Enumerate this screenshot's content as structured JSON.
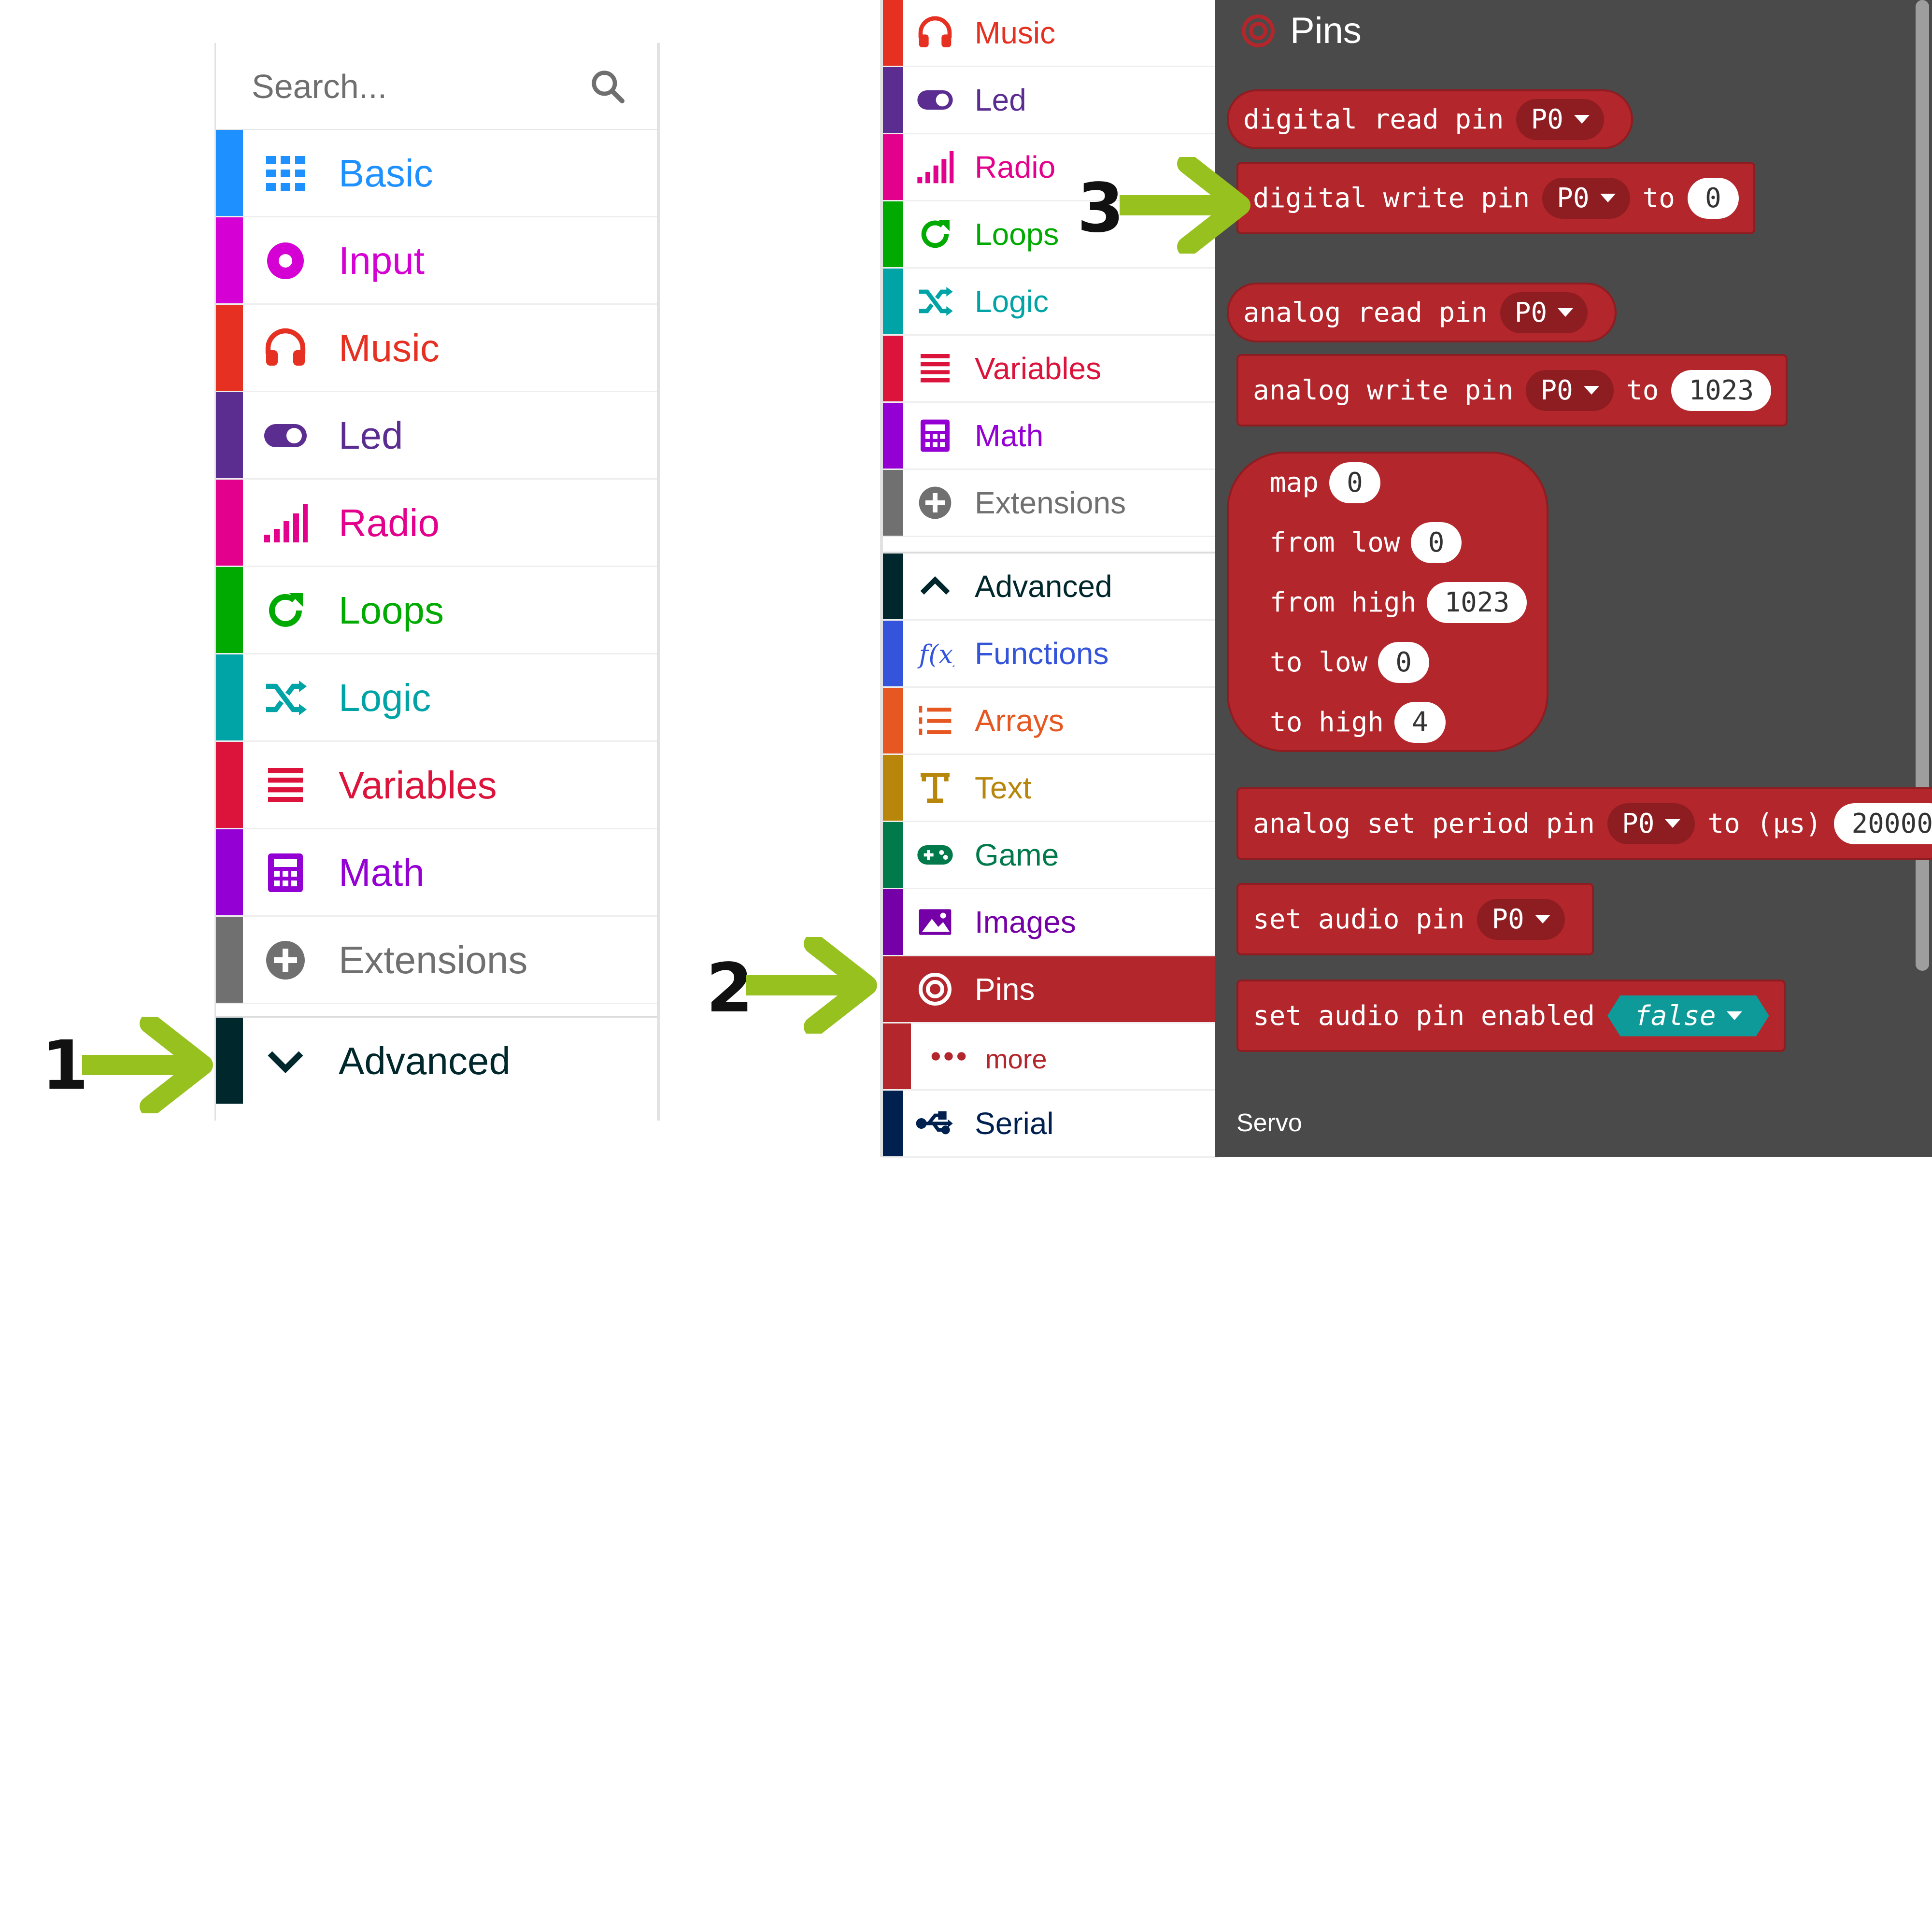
{
  "left_toolbox": {
    "search_placeholder": "Search...",
    "items": [
      {
        "label": "Basic",
        "color": "#1e90ff"
      },
      {
        "label": "Input",
        "color": "#d400d4"
      },
      {
        "label": "Music",
        "color": "#e63022"
      },
      {
        "label": "Led",
        "color": "#5c2d91"
      },
      {
        "label": "Radio",
        "color": "#e3008c"
      },
      {
        "label": "Loops",
        "color": "#00aa00"
      },
      {
        "label": "Logic",
        "color": "#00a4a6"
      },
      {
        "label": "Variables",
        "color": "#dc143c"
      },
      {
        "label": "Math",
        "color": "#9400d3"
      },
      {
        "label": "Extensions",
        "color": "#707070"
      }
    ],
    "advanced": {
      "label": "Advanced",
      "color": "#00272b"
    }
  },
  "mid_toolbox": {
    "items": [
      {
        "label": "Music",
        "color": "#e63022"
      },
      {
        "label": "Led",
        "color": "#5c2d91"
      },
      {
        "label": "Radio",
        "color": "#e3008c"
      },
      {
        "label": "Loops",
        "color": "#00aa00"
      },
      {
        "label": "Logic",
        "color": "#00a4a6"
      },
      {
        "label": "Variables",
        "color": "#dc143c"
      },
      {
        "label": "Math",
        "color": "#9400d3"
      },
      {
        "label": "Extensions",
        "color": "#707070"
      }
    ],
    "advanced_items": [
      {
        "label": "Advanced",
        "color": "#00272b"
      },
      {
        "label": "Functions",
        "color": "#3455db"
      },
      {
        "label": "Arrays",
        "color": "#e65722"
      },
      {
        "label": "Text",
        "color": "#b8860b"
      },
      {
        "label": "Game",
        "color": "#007a4b"
      },
      {
        "label": "Images",
        "color": "#7600a8"
      },
      {
        "label": "Pins",
        "color": "#b3262b"
      },
      {
        "label": "more",
        "color": "#b3262b"
      },
      {
        "label": "Serial",
        "color": "#002050"
      }
    ]
  },
  "flyout": {
    "title": "Pins",
    "blocks": {
      "digital_read": {
        "text": "digital read pin",
        "pin": "P0"
      },
      "digital_write": {
        "text": "digital write pin",
        "pin": "P0",
        "to": "to",
        "value": "0"
      },
      "analog_read": {
        "text": "analog read pin",
        "pin": "P0"
      },
      "analog_write": {
        "text": "analog write pin",
        "pin": "P0",
        "to": "to",
        "value": "1023"
      },
      "map": {
        "map": "map",
        "map_value": "0",
        "from_low": "from low",
        "from_low_value": "0",
        "from_high": "from high",
        "from_high_value": "1023",
        "to_low": "to low",
        "to_low_value": "0",
        "to_high": "to high",
        "to_high_value": "4"
      },
      "analog_set_period": {
        "text": "analog set period pin",
        "pin": "P0",
        "to": "to (µs)",
        "value": "20000"
      },
      "set_audio_pin": {
        "text": "set audio pin",
        "pin": "P0"
      },
      "set_audio_enabled": {
        "text": "set audio pin enabled",
        "value": "false"
      }
    },
    "section": "Servo"
  },
  "annotations": {
    "step1": "1",
    "step2": "2",
    "step3": "3",
    "arrow_color": "#97c11f"
  }
}
